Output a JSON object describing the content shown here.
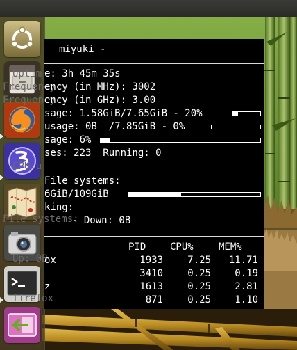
{
  "conky": {
    "hostname": "miyuki -",
    "uptime": "e: 3h 45m 35s",
    "freq_mhz": "ency (in MHz): 3002",
    "freq_ghz": "ency (in GHz): 3.00",
    "ram": "sage: 1.58GiB/7.65GiB - 20%",
    "ram_pct": 20,
    "swap": "usage: 0B  /7.85GiB - 0%",
    "swap_pct": 0,
    "cpu_usage": "sage: 6%",
    "cpu_pct": 6,
    "processes": "ses: 223  Running: 0",
    "fs_label": "File systems:",
    "fs_usage": "6GiB/109GiB",
    "fs_pct": 40,
    "networking_label": "king:",
    "net_line": "- Down: 0B",
    "ghost_text": {
      "uptime": "Uptim",
      "freq_mhz": "Frequency",
      "freq_ghz": "Frequency",
      "cpu": "CPU u",
      "fs": "File systems:",
      "net": "Up: 0B",
      "firefox": "firefox"
    },
    "columns": {
      "pid": "PID",
      "cpu": "CPU%",
      "mem": "MEM%"
    },
    "processes_list": [
      {
        "name": "ox",
        "pid": "1933",
        "cpu": "7.25",
        "mem": "11.71"
      },
      {
        "name": "",
        "pid": "3410",
        "cpu": "0.25",
        "mem": "0.19"
      },
      {
        "name": "z",
        "pid": "1613",
        "cpu": "0.25",
        "mem": "2.81"
      },
      {
        "name": "",
        "pid": "871",
        "cpu": "0.25",
        "mem": "1.10"
      }
    ]
  },
  "launcher": {
    "items": [
      {
        "name": "ubuntu-dash",
        "icon": "ubuntu-logo-icon"
      },
      {
        "name": "files",
        "icon": "file-cabinet-icon"
      },
      {
        "name": "firefox",
        "icon": "firefox-icon",
        "running": true
      },
      {
        "name": "emacs",
        "icon": "emacs-icon",
        "running": true
      },
      {
        "name": "map-viewer",
        "icon": "map-icon"
      },
      {
        "name": "camera",
        "icon": "camera-icon"
      },
      {
        "name": "terminal",
        "icon": "terminal-icon",
        "running": true
      },
      {
        "name": "remote-desktop",
        "icon": "arrow-panel-icon"
      }
    ]
  },
  "colors": {
    "conky_bg": "#000000",
    "conky_text": "#ffffff",
    "launcher_bg": "#463c23"
  }
}
